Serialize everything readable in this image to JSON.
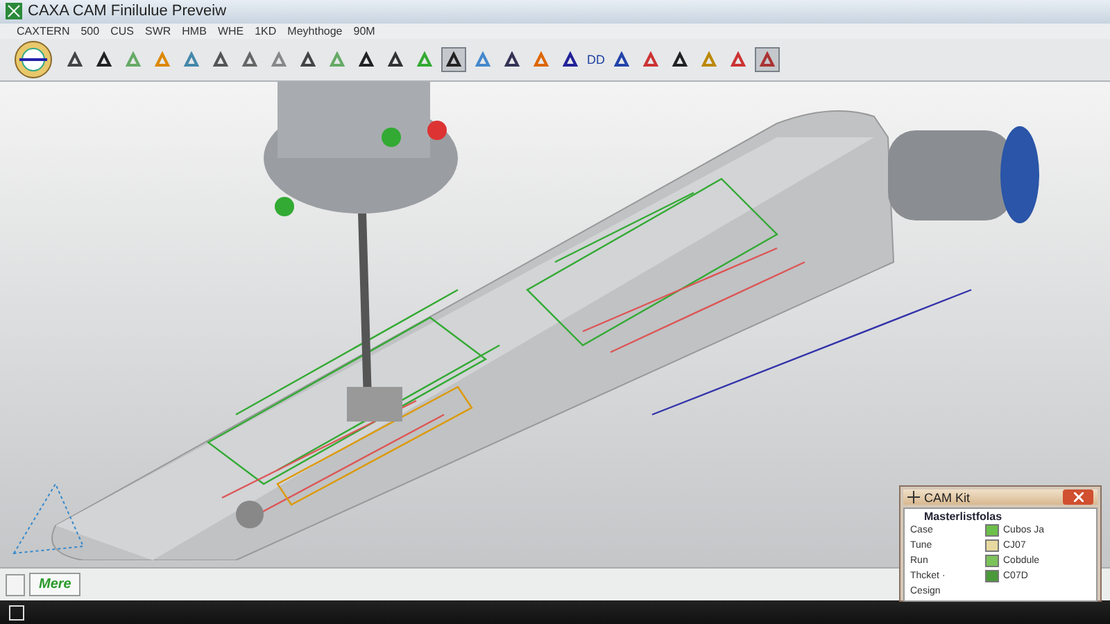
{
  "window": {
    "title": "CAXA CAM Finilulue Preveiw"
  },
  "menu": [
    "CAXTERN",
    "500",
    "CUS",
    "SWR",
    "HMB",
    "WHE",
    "1KD",
    "Meyhthoge",
    "90M"
  ],
  "toolbar": {
    "label": "DD",
    "buttons": [
      {
        "selected": false
      },
      {
        "selected": false
      },
      {
        "selected": false
      },
      {
        "selected": false
      },
      {
        "selected": false
      },
      {
        "selected": false
      },
      {
        "selected": false
      },
      {
        "selected": false
      },
      {
        "selected": false
      },
      {
        "selected": false
      },
      {
        "selected": false
      },
      {
        "selected": false
      },
      {
        "selected": false
      },
      {
        "selected": true
      },
      {
        "selected": false
      },
      {
        "selected": false
      },
      {
        "selected": false
      },
      {
        "selected": false
      },
      {
        "selected": false
      },
      {
        "selected": false
      },
      {
        "selected": false
      },
      {
        "selected": false
      },
      {
        "selected": false
      },
      {
        "selected": true
      }
    ]
  },
  "status_bar": {
    "tab": "Mere"
  },
  "cam_panel": {
    "title": "CAM Kit",
    "header": "Masterlistfolas",
    "rows": [
      {
        "name": "Case",
        "value": "Cubos Ja",
        "color": "#6cbf4a"
      },
      {
        "name": "Tune",
        "value": "CJ07",
        "color": "#e8d9a0"
      },
      {
        "name": "Run",
        "value": "Cobdule",
        "color": "#7cc35a"
      },
      {
        "name": "Thcket ·",
        "value": "C07D",
        "color": "#4a9a3a"
      },
      {
        "name": "Cesign"
      }
    ]
  }
}
